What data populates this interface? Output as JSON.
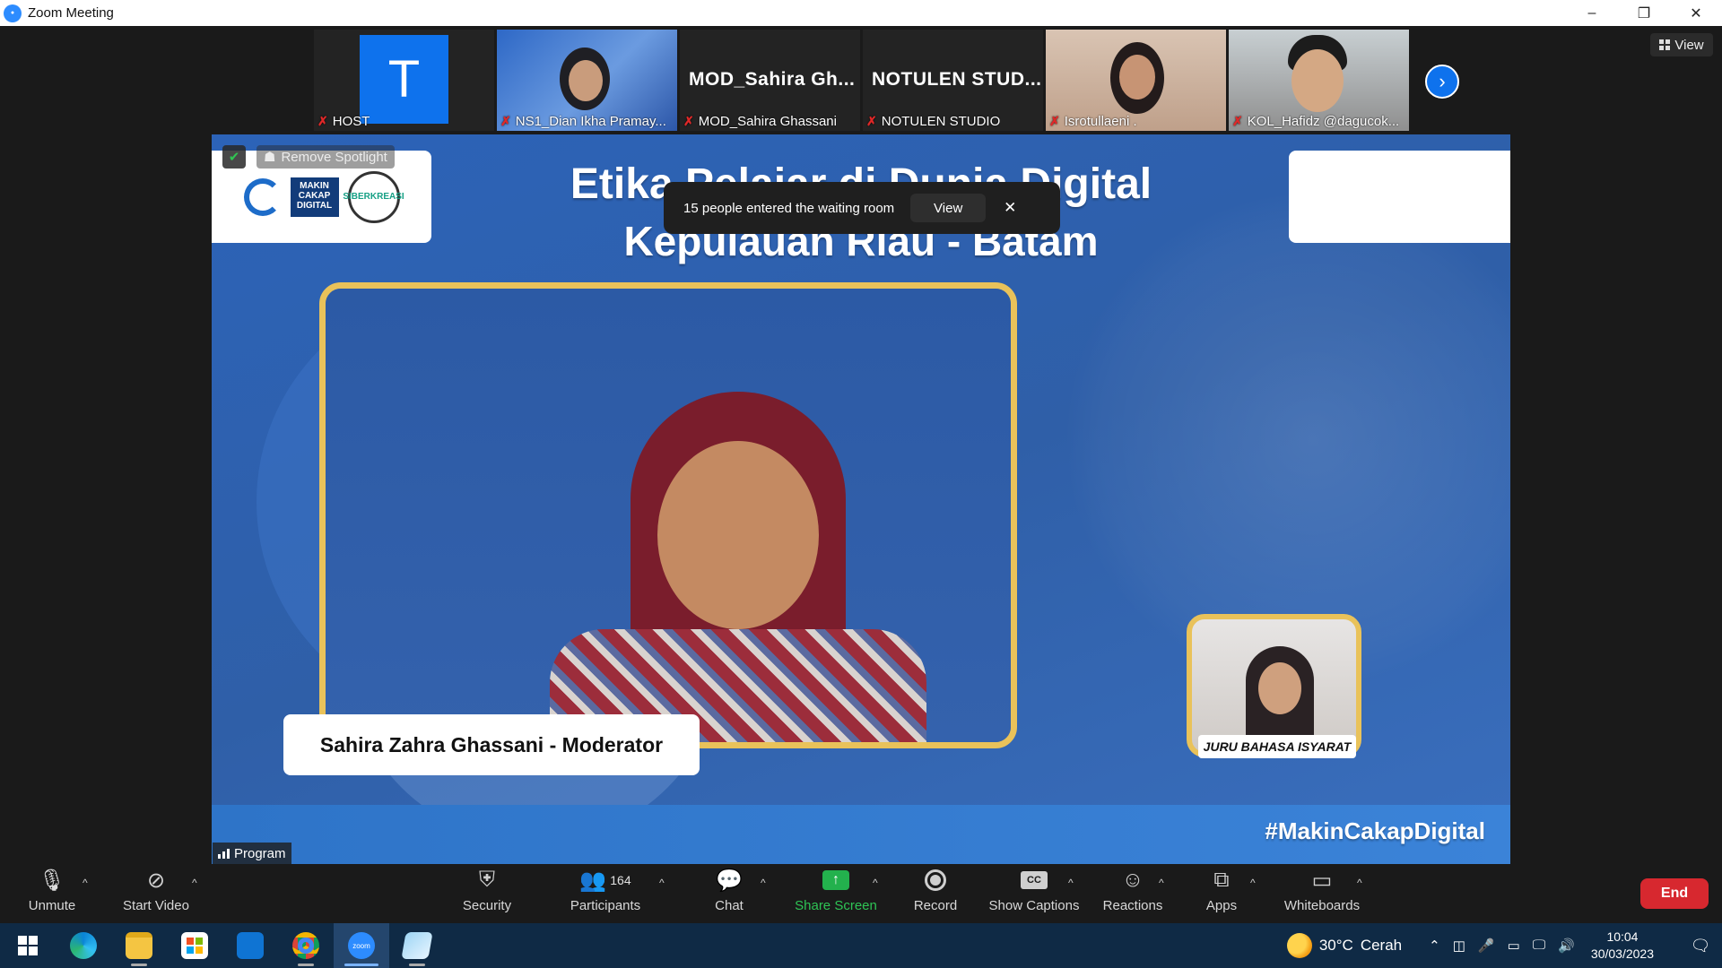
{
  "window": {
    "title": "Zoom Meeting",
    "minimize_icon": "–",
    "restore_icon": "❐",
    "close_icon": "✕"
  },
  "thumbnails": [
    {
      "name": "HOST",
      "avatar_letter": "T",
      "muted": true
    },
    {
      "name": "NS1_Dian Ikha Pramay...",
      "muted": true
    },
    {
      "name": "MOD_Sahira Ghassani",
      "display": "MOD_Sahira  Gh...",
      "muted": true
    },
    {
      "name": "NOTULEN STUDIO",
      "display": "NOTULEN  STUD...",
      "muted": true
    },
    {
      "name": "Isrotullaeni .",
      "muted": true
    },
    {
      "name": "KOL_Hafidz @dagucok...",
      "muted": true
    }
  ],
  "view_button": {
    "label": "View"
  },
  "stage": {
    "title_line1": "Etika Pelajar di Dunia Digital",
    "title_line2": "Kepulauan Riau - Batam",
    "presenter_label": "Sahira Zahra Ghassani - Moderator",
    "interpreter_label": "JURU BAHASA ISYARAT",
    "hashtag": "#MakinCakapDigital",
    "logo2_text": "MAKIN CAKAP DIGITAL",
    "logo3_text": "SIBERKREASI",
    "remove_spotlight": "Remove Spotlight",
    "program_label": "Program"
  },
  "toast": {
    "message": "15 people entered the waiting room",
    "view_label": "View"
  },
  "toolbar": {
    "unmute": "Unmute",
    "start_video": "Start Video",
    "security": "Security",
    "participants": "Participants",
    "participants_count": "164",
    "chat": "Chat",
    "share_screen": "Share Screen",
    "record": "Record",
    "show_captions": "Show Captions",
    "cc_text": "CC",
    "reactions": "Reactions",
    "apps": "Apps",
    "whiteboards": "Whiteboards",
    "end": "End"
  },
  "taskbar": {
    "temperature": "30°C",
    "weather": "Cerah",
    "time": "10:04",
    "date": "30/03/2023",
    "zoom_icon_text": "zoom"
  },
  "colors": {
    "accent": "#0e72ed",
    "end_red": "#d7282f",
    "share_green": "#23b14d",
    "frame_gold": "#e9c25a",
    "stage_blue": "#2f5fa8"
  }
}
